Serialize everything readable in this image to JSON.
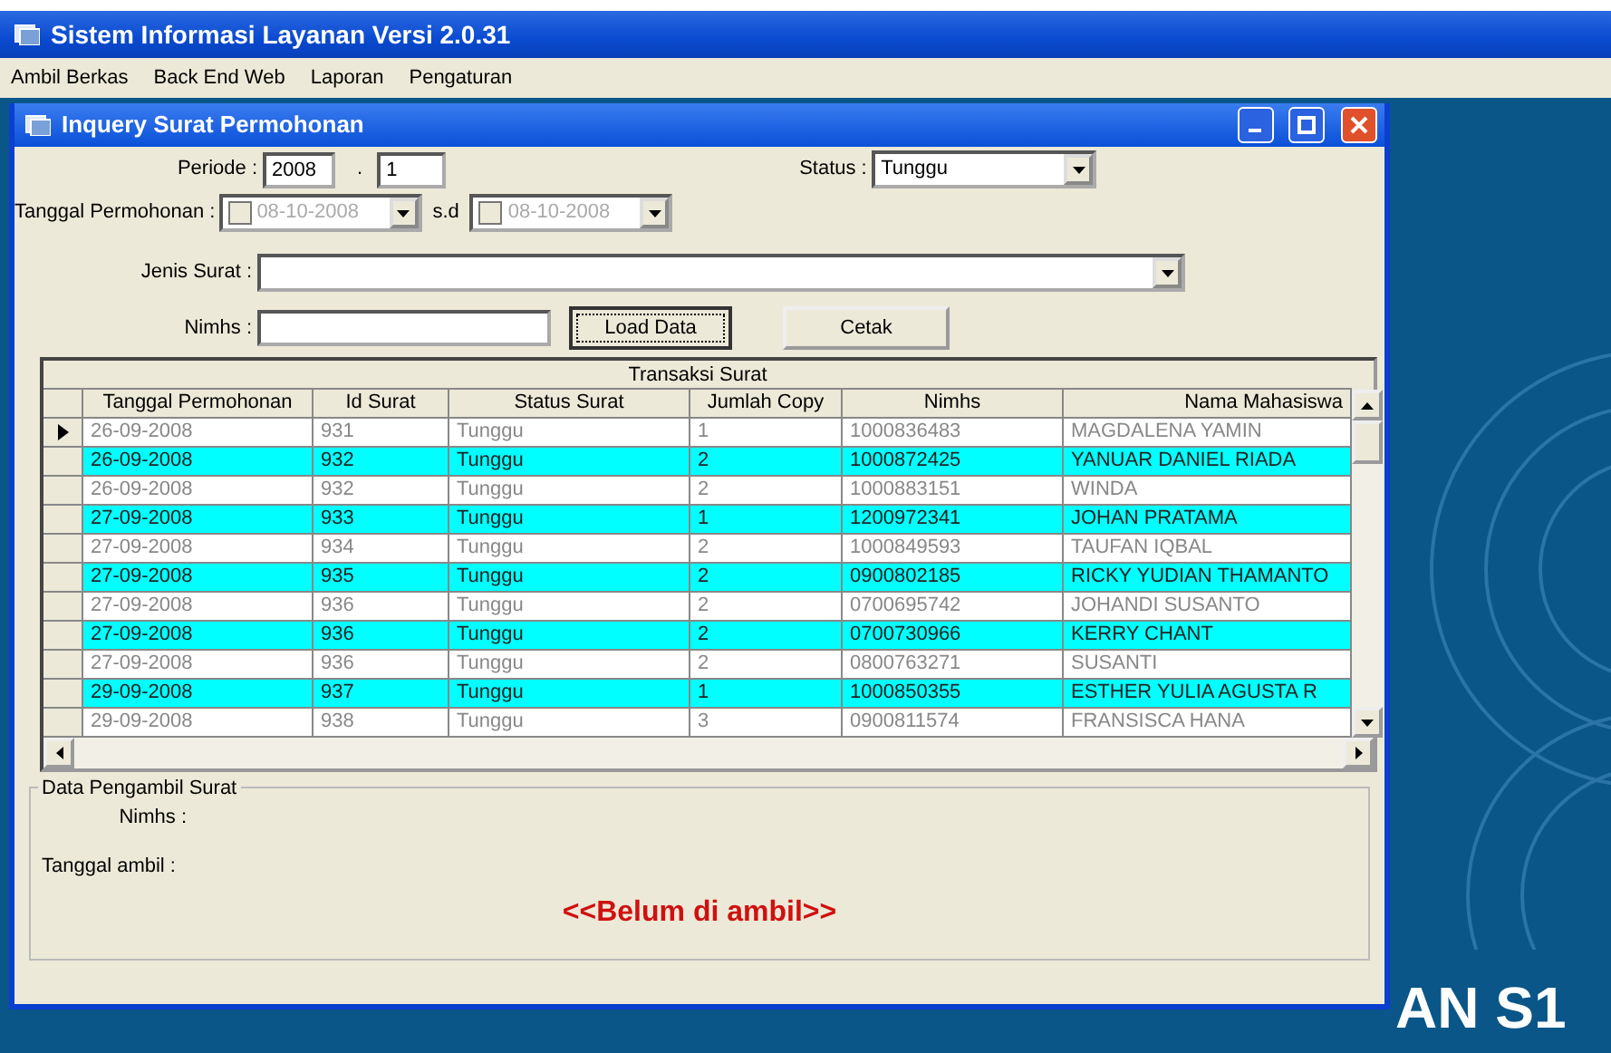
{
  "app": {
    "title": "Sistem Informasi Layanan Versi 2.0.31",
    "menu": [
      "Ambil Berkas",
      "Back End Web",
      "Laporan",
      "Pengaturan"
    ]
  },
  "child_window": {
    "title": "Inquery Surat Permohonan"
  },
  "form": {
    "periode_label": "Periode :",
    "periode_year": "2008",
    "periode_sep": ".",
    "periode_term": "1",
    "status_label": "Status :",
    "status_value": "Tunggu",
    "tanggal_label": "Tanggal Permohonan :",
    "date_from": {
      "value": "08-10-2008",
      "checked": false,
      "disabled": true
    },
    "range_sep": "s.d",
    "date_to": {
      "value": "08-10-2008",
      "checked": false,
      "disabled": true
    },
    "jenis_label": "Jenis Surat :",
    "nimhs_label": "Nimhs :",
    "buttons": [
      {
        "label": "Load Data",
        "focused": true
      },
      {
        "label": "Cetak",
        "focused": false
      }
    ]
  },
  "table": {
    "caption": "Transaksi Surat",
    "columns": [
      "Tanggal Permohonan",
      "Id Surat",
      "Status Surat",
      "Jumlah Copy",
      "Nimhs",
      "Nama Mahasiswa"
    ],
    "rows": [
      {
        "current": true,
        "highlighted": false,
        "cells": [
          "26-09-2008",
          "931",
          "Tunggu",
          "1",
          "1000836483",
          "MAGDALENA YAMIN"
        ]
      },
      {
        "current": false,
        "highlighted": true,
        "cells": [
          "26-09-2008",
          "932",
          "Tunggu",
          "2",
          "1000872425",
          "YANUAR DANIEL RIADA"
        ]
      },
      {
        "current": false,
        "highlighted": false,
        "cells": [
          "26-09-2008",
          "932",
          "Tunggu",
          "2",
          "1000883151",
          "WINDA"
        ]
      },
      {
        "current": false,
        "highlighted": true,
        "cells": [
          "27-09-2008",
          "933",
          "Tunggu",
          "1",
          "1200972341",
          "JOHAN PRATAMA"
        ]
      },
      {
        "current": false,
        "highlighted": false,
        "cells": [
          "27-09-2008",
          "934",
          "Tunggu",
          "2",
          "1000849593",
          "TAUFAN IQBAL"
        ]
      },
      {
        "current": false,
        "highlighted": true,
        "cells": [
          "27-09-2008",
          "935",
          "Tunggu",
          "2",
          "0900802185",
          "RICKY YUDIAN THAMANTO"
        ]
      },
      {
        "current": false,
        "highlighted": false,
        "cells": [
          "27-09-2008",
          "936",
          "Tunggu",
          "2",
          "0700695742",
          "JOHANDI SUSANTO"
        ]
      },
      {
        "current": false,
        "highlighted": true,
        "cells": [
          "27-09-2008",
          "936",
          "Tunggu",
          "2",
          "0700730966",
          "KERRY CHANT"
        ]
      },
      {
        "current": false,
        "highlighted": false,
        "cells": [
          "27-09-2008",
          "936",
          "Tunggu",
          "2",
          "0800763271",
          "SUSANTI"
        ]
      },
      {
        "current": false,
        "highlighted": true,
        "cells": [
          "29-09-2008",
          "937",
          "Tunggu",
          "1",
          "1000850355",
          "ESTHER YULIA AGUSTA R"
        ]
      },
      {
        "current": false,
        "highlighted": false,
        "cells": [
          "29-09-2008",
          "938",
          "Tunggu",
          "3",
          "0900811574",
          "FRANSISCA HANA"
        ]
      }
    ]
  },
  "pickup": {
    "title": "Data Pengambil Surat",
    "nimhs_label": "Nimhs :",
    "tanggal_label": "Tanggal ambil :",
    "message": "<<Belum di ambil>>"
  },
  "desktop": {
    "banner": "AN S1"
  }
}
